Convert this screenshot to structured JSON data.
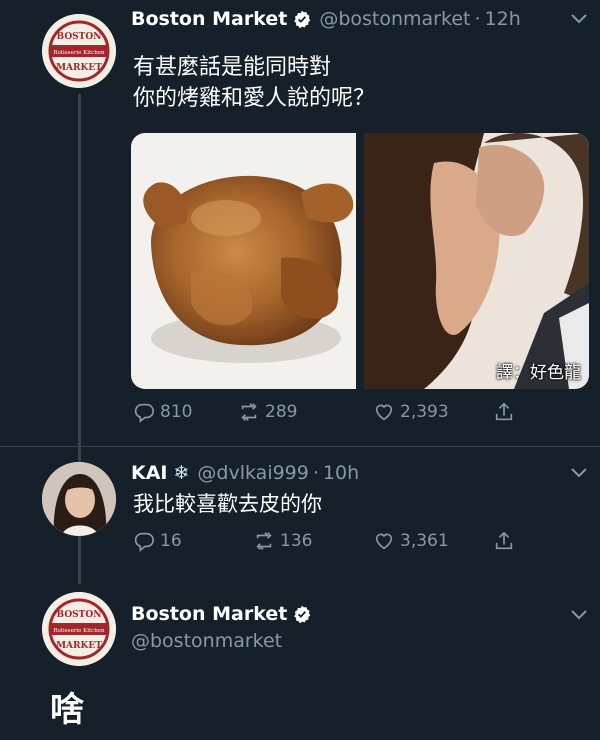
{
  "tweet1": {
    "author_name": "Boston Market",
    "handle": "@bostonmarket",
    "time": "12h",
    "text": "有甚麼話是能同時對\n你的烤雞和愛人說的呢？",
    "watermark": "譯：好色龍",
    "replies": "810",
    "retweets": "289",
    "likes": "2,393"
  },
  "tweet2": {
    "author_name": "KAI",
    "handle": "@dvlkai999",
    "time": "10h",
    "text": "我比較喜歡去皮的你",
    "replies": "16",
    "retweets": "136",
    "likes": "3,361"
  },
  "tweet3": {
    "author_name": "Boston Market",
    "handle": "@bostonmarket",
    "text": "啥"
  },
  "logo": {
    "top": "BOSTON",
    "middle": "Rotisserie Kitchen",
    "bottom": "MARKET"
  },
  "colors": {
    "background": "#15202b",
    "muted": "#8899a6",
    "verified": "#ffffff",
    "divider": "#38444d",
    "logo_red": "#a3262a"
  }
}
